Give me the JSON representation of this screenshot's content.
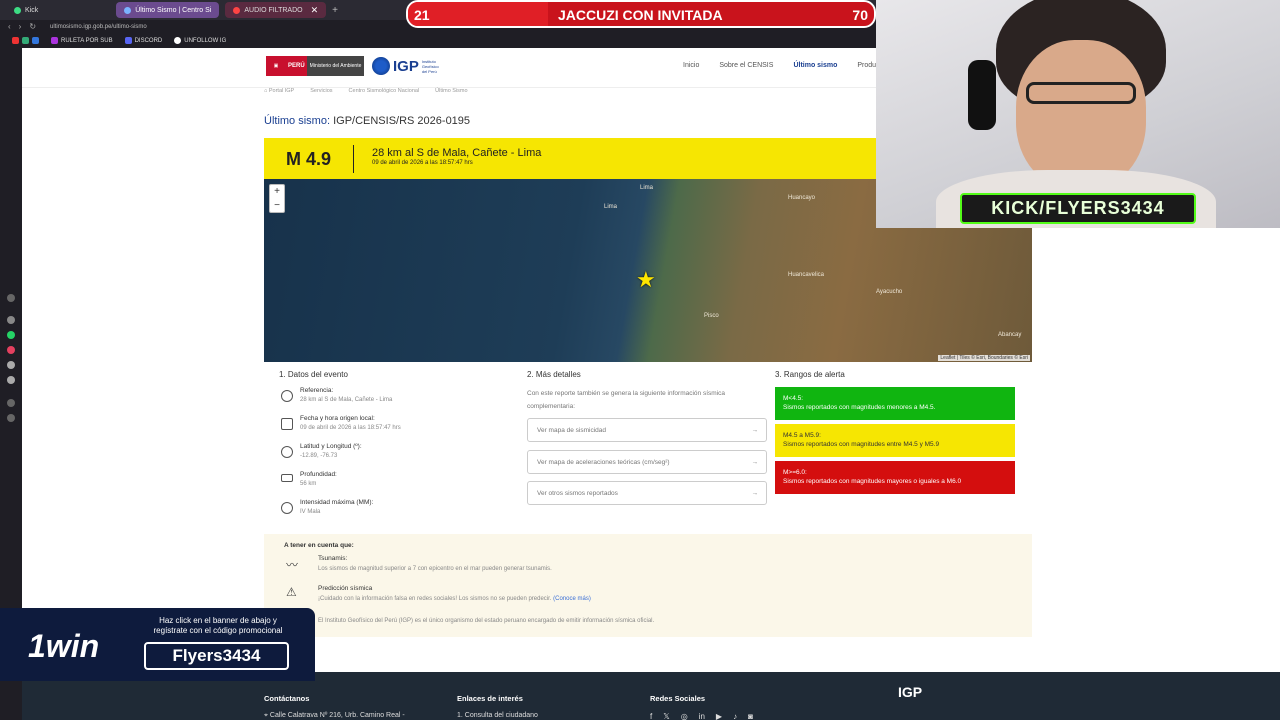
{
  "browser": {
    "tabs": [
      {
        "label": "Kick"
      },
      {
        "label": "Último Sismo | Centro Si"
      },
      {
        "label": "AUDIO FILTRADO"
      }
    ],
    "url": "ultimosismo.igp.gob.pe/ultimo-sismo",
    "bookmarks": [
      "RULETA POR SUB",
      "DISCORD",
      "UNFOLLOW IG"
    ]
  },
  "header": {
    "peru_label": "PERÚ",
    "ministry": "Ministerio del Ambiente",
    "igp_logo": "IGP",
    "igp_sub": "Instituto Geofísico del Perú",
    "nav": [
      "Inicio",
      "Sobre el CENSIS",
      "Último sismo",
      "Product"
    ]
  },
  "breadcrumb": [
    "Portal IGP",
    "Servicios",
    "Centro Sismológico Nacional",
    "Último Sismo"
  ],
  "title": {
    "lead": "Último sismo:",
    "code": "IGP/CENSIS/RS 2026-0195"
  },
  "quake": {
    "magnitude": "M 4.9",
    "place": "28 km al S de Mala, Cañete - Lima",
    "date": "09 de abril de 2026 a las 18:57:47 hrs"
  },
  "map": {
    "zoom_in": "+",
    "zoom_out": "−",
    "cities": [
      "Lima",
      "Lima",
      "Huancayo",
      "Huancavelica",
      "Ayacucho",
      "Pisco",
      "Abancay"
    ],
    "attribution": "Leaflet | Tiles © Esri, Boundaries © Esri"
  },
  "event": {
    "heading": "1. Datos del evento",
    "items": [
      {
        "label": "Referencia:",
        "value": "28 km al S de Mala, Cañete - Lima"
      },
      {
        "label": "Fecha y hora origen local:",
        "value": "09 de abril de 2026 a las 18:57:47 hrs"
      },
      {
        "label": "Latitud y Longitud (º):",
        "value": "-12.89, -76.73"
      },
      {
        "label": "Profundidad:",
        "value": "56 km"
      },
      {
        "label": "Intensidad máxima (MM):",
        "value": "IV Mala"
      }
    ]
  },
  "details": {
    "heading": "2. Más detalles",
    "intro": "Con este reporte también se genera la siguiente información sísmica complementaria:",
    "buttons": [
      "Ver mapa de sismicidad",
      "Ver mapa de aceleraciones teóricas (cm/seg²)",
      "Ver otros sismos reportados"
    ]
  },
  "alerts": {
    "heading": "3. Rangos de alerta",
    "items": [
      {
        "range": "M<4.5:",
        "text": "Sismos reportados con magnitudes menores a M4.5."
      },
      {
        "range": "M4.5 a M5.9:",
        "text": "Sismos reportados con magnitudes entre M4.5 y M5.9"
      },
      {
        "range": "M>=6.0:",
        "text": "Sismos reportados con magnitudes mayores o iguales a M6.0"
      }
    ],
    "colors": [
      "#10b510",
      "#f6e602",
      "#d40e0e"
    ]
  },
  "notes": {
    "heading": "A tener en cuenta que:",
    "tsunami_title": "Tsunamis:",
    "tsunami_text": "Los sismos de magnitud superior a 7 con epicentro en el mar pueden generar tsunamis.",
    "prediction_title": "Predicción sísmica",
    "prediction_text": "¡Cuidado con la información falsa en redes sociales! Los sismos no se pueden predecir.",
    "prediction_link": "(Conoce más)",
    "igp_text": "El Instituto Geofísico del Perú (IGP) es el único organismo del estado peruano encargado de emitir información sísmica oficial."
  },
  "footer": {
    "contact_h": "Contáctanos",
    "contact_t": "Calle Calatrava Nº 216, Urb. Camino Real -",
    "links_h": "Enlaces de interés",
    "links_t": "1. Consulta del ciudadano",
    "social_h": "Redes Sociales",
    "social_icons": [
      "f",
      "𝕏",
      "◎",
      "in",
      "▶",
      "♪",
      "◙"
    ],
    "logo": "IGP"
  },
  "overlay": {
    "banner_left": "21",
    "banner_label": "JACCUZI CON INVITADA",
    "banner_right": "70",
    "kick_tag": "KICK/FLYERS3434",
    "ad_brand": "1win",
    "ad_msg": "Haz click en el banner de abajo y regístrate con el código promocional",
    "ad_code": "Flyers3434"
  }
}
